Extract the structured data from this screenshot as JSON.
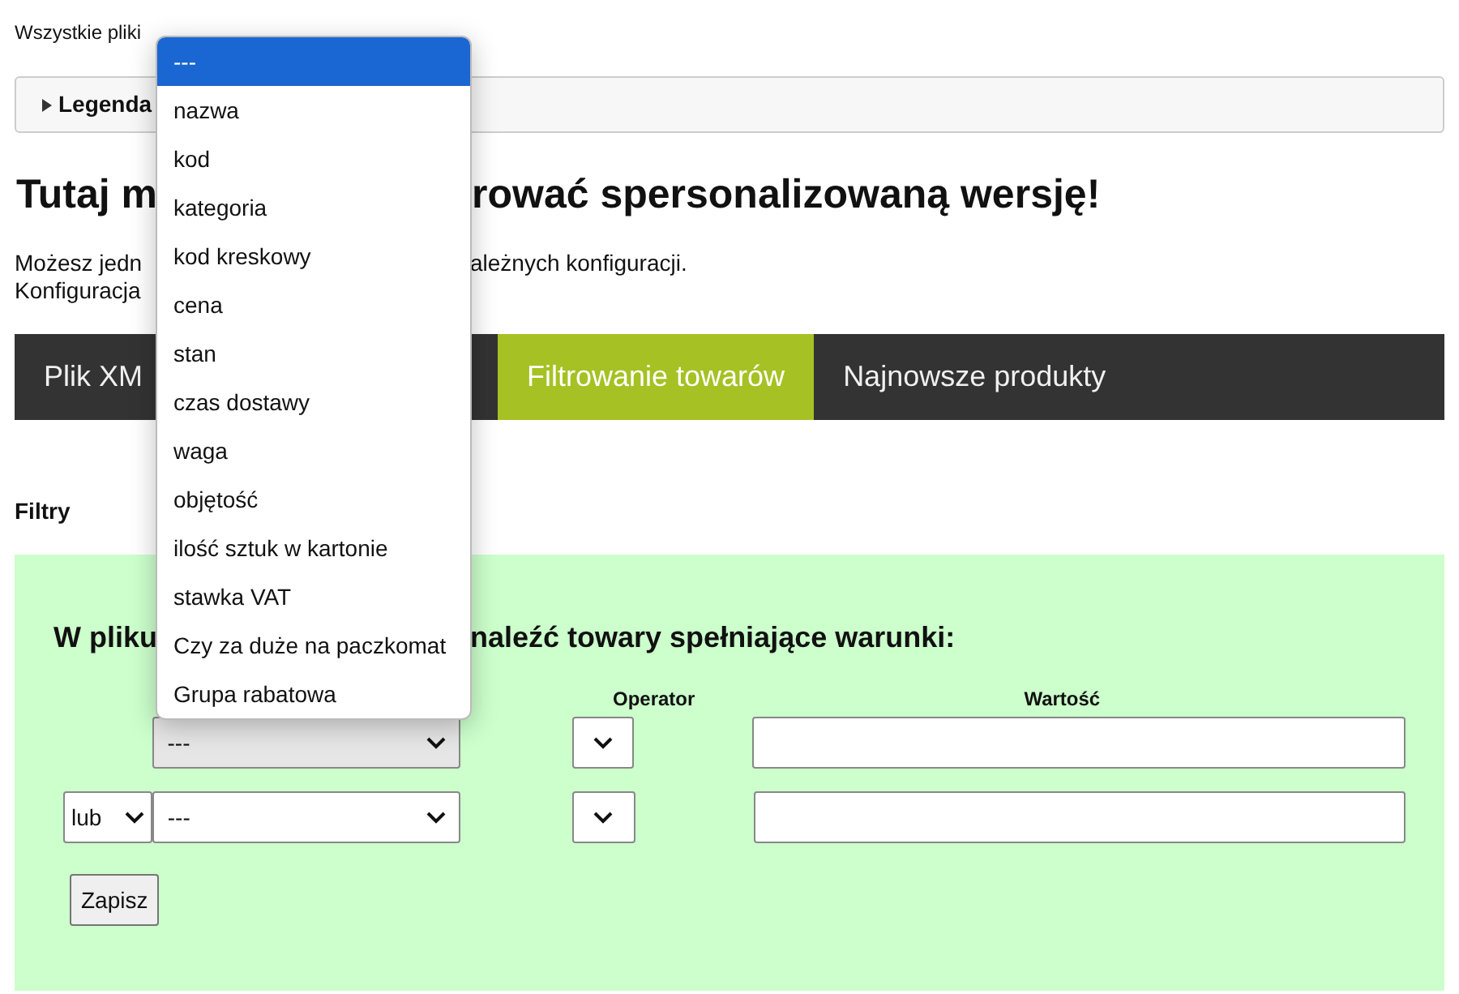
{
  "encoding_note": "Wszystkie pliki",
  "legend": {
    "label": "Legenda",
    "expanded": false
  },
  "heading": {
    "left": "Tutaj m",
    "right": "rować spersonalizowaną wersję!"
  },
  "intro": [
    {
      "left": "Możesz jedn",
      "right": "ależnych konfiguracji."
    },
    {
      "left": "Konfiguracja"
    }
  ],
  "tabs": [
    {
      "label": "Plik XM",
      "selected": false
    },
    {
      "label": "Filtrowanie towarów",
      "selected": true
    },
    {
      "label": "Najnowsze produkty",
      "selected": false
    }
  ],
  "section_title": "Filtry",
  "filter_panel": {
    "title": {
      "left": "W pliku",
      "right": "naleźć towary spełniające warunki:"
    },
    "columns": [
      "Operator",
      "Wartość"
    ],
    "rows": [
      {
        "field": "---"
      },
      {
        "connector": "lub",
        "field": "---"
      }
    ],
    "save_button": "Zapisz"
  },
  "dropdown": {
    "options": [
      {
        "label": "---",
        "selected": true
      },
      {
        "label": "nazwa",
        "selected": false
      },
      {
        "label": "kod",
        "selected": false
      },
      {
        "label": "kategoria",
        "selected": false
      },
      {
        "label": "kod kreskowy",
        "selected": false
      },
      {
        "label": "cena",
        "selected": false
      },
      {
        "label": "stan",
        "selected": false
      },
      {
        "label": "czas dostawy",
        "selected": false
      },
      {
        "label": "waga",
        "selected": false
      },
      {
        "label": "objętość",
        "selected": false
      },
      {
        "label": "ilość sztuk w kartonie",
        "selected": false
      },
      {
        "label": "stawka VAT",
        "selected": false
      },
      {
        "label": "Czy za duże na paczkomat",
        "selected": false
      },
      {
        "label": "Grupa rabatowa",
        "selected": false
      }
    ]
  }
}
